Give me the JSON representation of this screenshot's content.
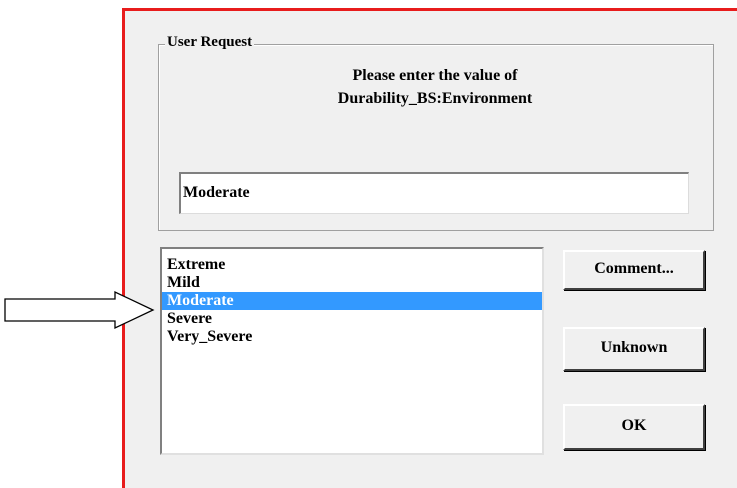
{
  "dialog": {
    "group_title": "User Request",
    "prompt_line1": "Please enter the value of",
    "prompt_line2": "Durability_BS:Environment",
    "input_value": "Moderate",
    "options": [
      "Extreme",
      "Mild",
      "Moderate",
      "Severe",
      "Very_Severe"
    ],
    "selected_option": "Moderate",
    "buttons": {
      "comment": "Comment...",
      "unknown": "Unknown",
      "ok": "OK"
    }
  },
  "annotation": {
    "pointer_icon": "right-arrow-outline-icon"
  },
  "colors": {
    "frame_border": "#e81c1c",
    "selection": "#3399ff"
  }
}
